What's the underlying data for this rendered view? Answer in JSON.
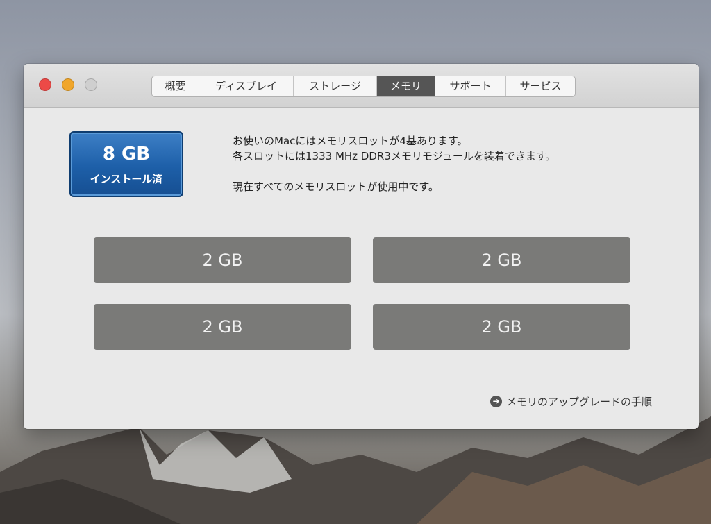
{
  "window": {
    "controls": [
      "close-button",
      "minimize-button",
      "zoom-button"
    ]
  },
  "tabs": [
    {
      "label": "概要",
      "active": false
    },
    {
      "label": "ディスプレイ",
      "active": false
    },
    {
      "label": "ストレージ",
      "active": false
    },
    {
      "label": "メモリ",
      "active": true
    },
    {
      "label": "サポート",
      "active": false
    },
    {
      "label": "サービス",
      "active": false
    }
  ],
  "memory": {
    "badge_size": "8 GB",
    "badge_label": "インストール済",
    "line1": "お使いのMacにはメモリスロットが4基あります。",
    "line2": "各スロットには1333 MHz DDR3メモリモジュールを装着できます。",
    "line3": "現在すべてのメモリスロットが使用中です。",
    "slots": [
      "2 GB",
      "2 GB",
      "2 GB",
      "2 GB"
    ],
    "upgrade_link": "メモリのアップグレードの手順"
  },
  "colors": {
    "badge_blue": "#1d5fa8",
    "slot_gray": "#7a7a78",
    "active_tab": "#555555",
    "close": "#ec4a47",
    "minimize": "#f0a62b"
  }
}
